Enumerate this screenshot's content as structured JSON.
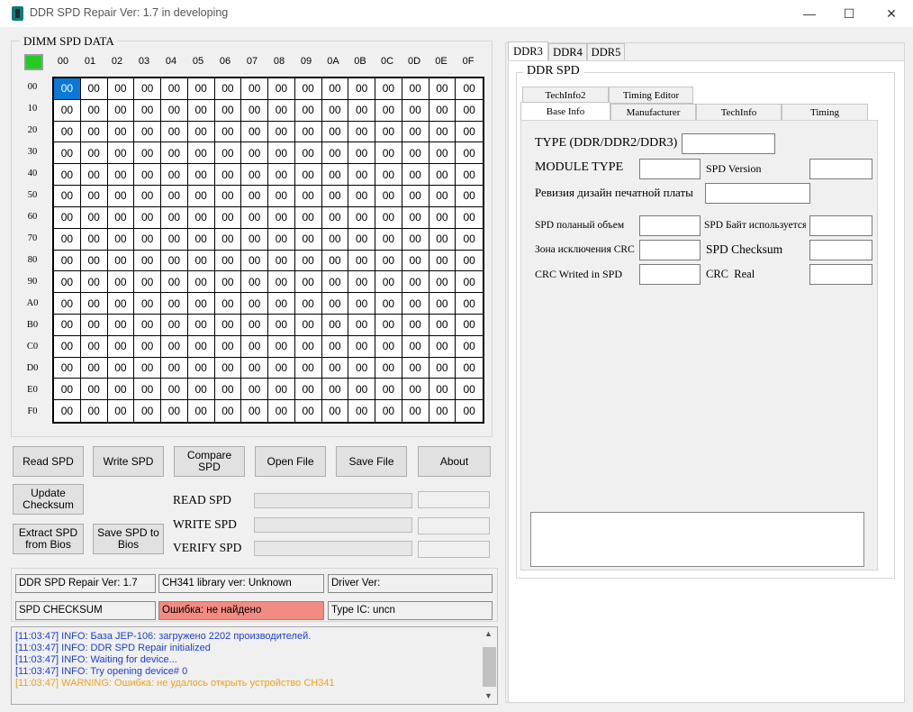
{
  "window": {
    "title": "DDR SPD Repair Ver: 1.7 in developing",
    "minimize": "—",
    "maximize": "☐",
    "close": "✕"
  },
  "dimm": {
    "title": "DIMM SPD DATA",
    "col_headers": [
      "00",
      "01",
      "02",
      "03",
      "04",
      "05",
      "06",
      "07",
      "08",
      "09",
      "0A",
      "0B",
      "0C",
      "0D",
      "0E",
      "0F"
    ],
    "row_headers": [
      "00",
      "10",
      "20",
      "30",
      "40",
      "50",
      "60",
      "70",
      "80",
      "90",
      "A0",
      "B0",
      "C0",
      "D0",
      "E0",
      "F0"
    ],
    "cell_value": "00",
    "selected_cell": 0
  },
  "buttons": {
    "read_spd": "Read SPD",
    "write_spd": "Write SPD",
    "compare_spd": "Compare SPD",
    "open_file": "Open File",
    "save_file": "Save File",
    "about": "About",
    "update_checksum": "Update Checksum",
    "extract_spd": "Extract SPD from Bios",
    "save_spd_bios": "Save SPD to Bios"
  },
  "progress": {
    "read": "READ SPD",
    "write": "WRITE SPD",
    "verify": "VERIFY SPD"
  },
  "status": {
    "version": "DDR SPD Repair Ver: 1.7",
    "ch341": "CH341 library ver: Unknown",
    "driver": "Driver Ver:",
    "checksum": "SPD CHECKSUM",
    "error": "Ошибка: не найдено",
    "type_ic": "Type IC: uncn"
  },
  "log": [
    {
      "text": "[11:03:47] INFO: База JEP-106: загружено 2202 производителей.",
      "color": "#1a3fd6"
    },
    {
      "text": "[11:03:47] INFO: DDR SPD Repair initialized",
      "color": "#1a3fd6"
    },
    {
      "text": "[11:03:47] INFO: Waiting for device...",
      "color": "#1a3fd6"
    },
    {
      "text": "[11:03:47] INFO: Try opening device# 0",
      "color": "#1a3fd6"
    },
    {
      "text": "[11:03:47] WARNING: Ошибка: не удалось открыть устройство CH341",
      "color": "#f0a020"
    }
  ],
  "right": {
    "tabs": [
      "DDR3",
      "DDR4",
      "DDR5"
    ],
    "group_title": "DDR SPD",
    "subtabs_row1": [
      "TechInfo2",
      "Timing Editor"
    ],
    "subtabs_row2": [
      "Base Info",
      "Manufacturer",
      "TechInfo",
      "Timing"
    ],
    "labels": {
      "type": "TYPE (DDR/DDR2/DDR3)",
      "module_type": "MODULE TYPE",
      "spd_version": "SPD Version",
      "pcb_revision": "Ревизия дизайн печатной платы",
      "spd_full_size": "SPD поланый объем",
      "spd_bytes_used": "SPD Байт используется",
      "crc_zone": "Зона исключения CRC",
      "spd_checksum": "SPD Checksum",
      "crc_written": "CRC Writed in SPD",
      "crc_real": "CRC  Real"
    }
  },
  "colors": {
    "accent_green": "#22cc22",
    "selection_blue": "#0a78d7",
    "error_bg": "#f28b82"
  }
}
